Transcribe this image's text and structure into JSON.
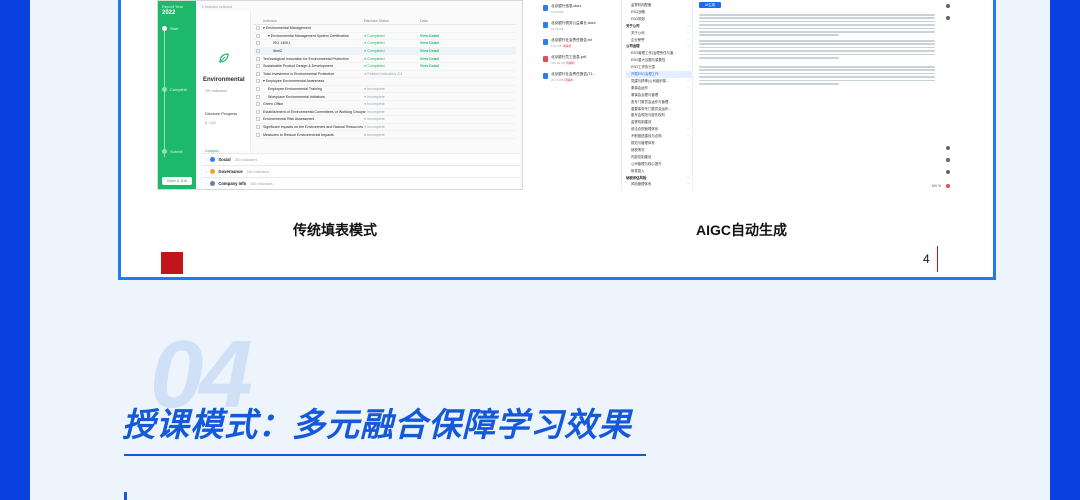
{
  "left_shot": {
    "sidebar": {
      "report_year_label": "Report Year",
      "year": "2022",
      "steps": [
        "Start",
        "Complete",
        "Submit"
      ],
      "save_exit": "Save & Exit"
    },
    "selected": "0 indicator selected",
    "category": {
      "title": "Environmental",
      "sub": "200 Indicators",
      "progress_label": "Disclose Progress",
      "progress_value": "8 / 200",
      "collapse": "Collapse"
    },
    "table": {
      "headers": [
        "Indicator",
        "Disclose Status",
        "Data"
      ],
      "rows": [
        {
          "name": "▾ Environmental Management",
          "status": "",
          "action": "",
          "indent": 0
        },
        {
          "name": "▾ Environmental Management System Certification",
          "status": "● Completed",
          "action": "View Detail",
          "indent": 1,
          "done": true
        },
        {
          "name": "ISO 14001",
          "status": "● Completed",
          "action": "View Detail",
          "indent": 2,
          "done": true
        },
        {
          "name": "Item2",
          "status": "● Completed",
          "action": "View Detail",
          "indent": 2,
          "done": true,
          "hl": true
        },
        {
          "name": "Technological Innovation for Environmental Protection",
          "status": "● Completed",
          "action": "View Detail",
          "indent": 0,
          "done": true
        },
        {
          "name": "Sustainable Product Design & Development",
          "status": "● Completed",
          "action": "View Detail",
          "indent": 0,
          "done": true
        },
        {
          "name": "Total Investment in Environmental Protection",
          "status": "● Related Indicators 2/4",
          "action": "",
          "indent": 0,
          "done": false
        },
        {
          "name": "▾ Employee Environmental Awareness",
          "status": "",
          "action": "",
          "indent": 0
        },
        {
          "name": "Employee Environmental Training",
          "status": "● Incomplete",
          "action": "",
          "indent": 1,
          "done": false
        },
        {
          "name": "Workplace Environmental Initiatives",
          "status": "● Incomplete",
          "action": "",
          "indent": 1,
          "done": false
        },
        {
          "name": "Green Office",
          "status": "● Incomplete",
          "action": "",
          "indent": 0,
          "done": false
        },
        {
          "name": "Establishment of Environmental Committees or Working Groups",
          "status": "● Incomplete",
          "action": "",
          "indent": 0,
          "done": false
        },
        {
          "name": "Environmental Risk Assessment",
          "status": "● Incomplete",
          "action": "",
          "indent": 0,
          "done": false
        },
        {
          "name": "Significant Impacts on the Environment and Natural Resources",
          "status": "● Incomplete",
          "action": "",
          "indent": 0,
          "done": false
        },
        {
          "name": "Measures to Reduce Environmental Impacts",
          "status": "● Incomplete",
          "action": "",
          "indent": 0,
          "done": false
        }
      ]
    },
    "categories": [
      {
        "name": "Social",
        "count": "200 Indicators",
        "color": "#2f7df0"
      },
      {
        "name": "Governance",
        "count": "150 Indicators",
        "color": "#f0a12f"
      },
      {
        "name": "Company Info",
        "count": "150 Indicators",
        "color": "#6b7fa0"
      }
    ]
  },
  "right_shot": {
    "files": [
      {
        "name": "北京银行信息.docx",
        "meta": "10.28 KB",
        "tag": "",
        "color": "#2f7df0"
      },
      {
        "name": "北京银行税务公益事业.docx",
        "meta": "15.28 KB",
        "tag": "",
        "color": "#2f7df0"
      },
      {
        "name": "北京银行社会责任报告.txt",
        "meta": "5.91 KB",
        "tag": "待解析",
        "color": "#2f7df0"
      },
      {
        "name": "北京银行员工信息.pdf",
        "meta": "416.00 KB",
        "tag": "待解析",
        "color": "#e34d4d"
      },
      {
        "name": "北京银行社会责任报告(T1...",
        "meta": "20.71 KB",
        "tag": "待解析",
        "color": "#2f7df0"
      }
    ],
    "tree": [
      {
        "label": "监督机构配备",
        "grp": false
      },
      {
        "label": "ESG战略",
        "grp": false
      },
      {
        "label": "ESG规划",
        "grp": false
      },
      {
        "label": "关于公司",
        "grp": true
      },
      {
        "label": "关于公司",
        "grp": false
      },
      {
        "label": "企业荣誉",
        "grp": false
      },
      {
        "label": "公司治理",
        "grp": true
      },
      {
        "label": "ESG管理工作(治理责任与道...",
        "grp": false
      },
      {
        "label": "ESG重大议题与重要性",
        "grp": false
      },
      {
        "label": "ESG工作执行层",
        "grp": false
      },
      {
        "label": "开展ESG治理工作",
        "grp": false,
        "active": true
      },
      {
        "label": "党建与精神(公司组织架...",
        "grp": false
      },
      {
        "label": "董事会运作",
        "grp": false
      },
      {
        "label": "董事会治理与管理",
        "grp": false
      },
      {
        "label": "各专门委员会运作与管理...",
        "grp": false
      },
      {
        "label": "重要事务专门委员会运作...",
        "grp": false
      },
      {
        "label": "股东会规范与股东权利",
        "grp": false
      },
      {
        "label": "监督机制建设",
        "grp": false
      },
      {
        "label": "依法合规管理体系",
        "grp": false
      },
      {
        "label": "不断推进建设与合规",
        "grp": false
      },
      {
        "label": "规范与管理体系",
        "grp": false
      },
      {
        "label": "纳税情况",
        "grp": false
      },
      {
        "label": "内部控制建设",
        "grp": false
      },
      {
        "label": "公司管理与核心提升",
        "grp": false
      },
      {
        "label": "研发投入",
        "grp": false
      },
      {
        "label": "纳税评估风险",
        "grp": true
      },
      {
        "label": "风险管理体系",
        "grp": false
      }
    ],
    "gen_button": "AI生成",
    "zoom": "100 %"
  },
  "captions": {
    "left": "传统填表模式",
    "right": "AIGC自动生成"
  },
  "page_number": "4",
  "section": {
    "number": "04",
    "title": "授课模式：多元融合保障学习效果"
  }
}
